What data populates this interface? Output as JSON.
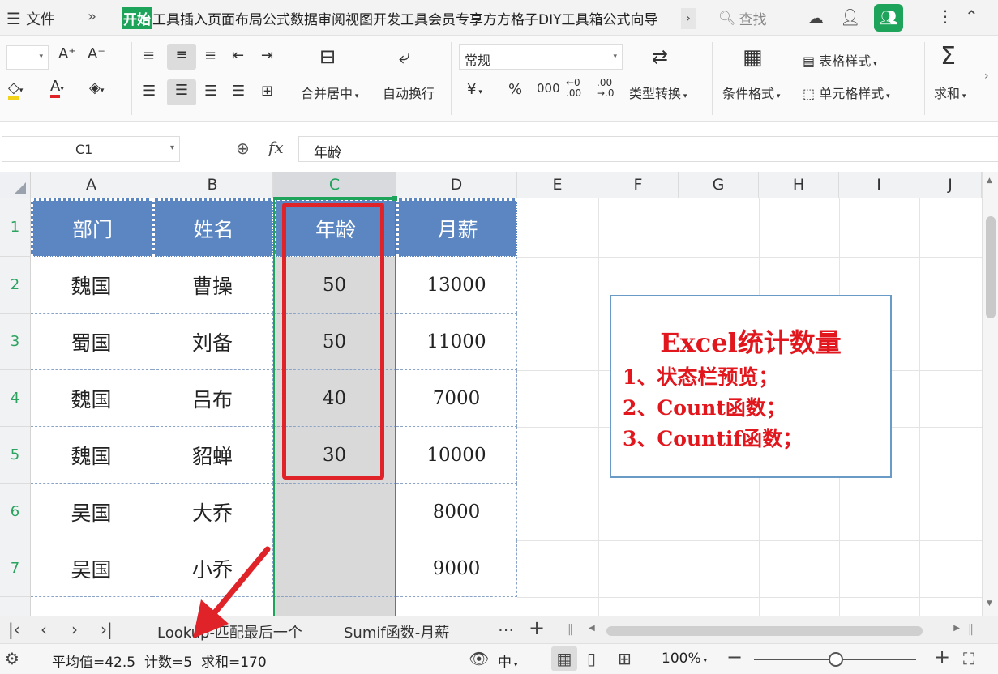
{
  "titlebar": {
    "menu_label": "文件",
    "tabs": [
      "开始",
      "工具",
      "插入",
      "页面布局",
      "公式",
      "数据",
      "审阅",
      "视图",
      "开发工具",
      "会员专享",
      "方方格子",
      "DIY工具箱",
      "公式向导"
    ],
    "search_label": "查找"
  },
  "ribbon": {
    "merge_label": "合并居中",
    "wrap_label": "自动换行",
    "number_format": "常规",
    "convert_label": "类型转换",
    "cond_format_label": "条件格式",
    "table_style_label": "表格样式",
    "cell_style_label": "单元格样式",
    "sum_label": "求和",
    "currency_symbol": "¥",
    "percent_symbol": "%",
    "thousands_symbol": "000",
    "inc_decimal_symbol": "←0\n.00",
    "dec_decimal_symbol": ".00\n→.0"
  },
  "formula_bar": {
    "name_box": "C1",
    "fx_label": "fx",
    "content": "年龄"
  },
  "columns": [
    "A",
    "B",
    "C",
    "D",
    "E",
    "F",
    "G",
    "H",
    "I",
    "J"
  ],
  "rows": [
    "1",
    "2",
    "3",
    "4",
    "5",
    "6",
    "7"
  ],
  "table": {
    "header": [
      "部门",
      "姓名",
      "年龄",
      "月薪"
    ],
    "rows": [
      [
        "魏国",
        "曹操",
        "50",
        "13000"
      ],
      [
        "蜀国",
        "刘备",
        "50",
        "11000"
      ],
      [
        "魏国",
        "吕布",
        "40",
        "7000"
      ],
      [
        "魏国",
        "貂蝉",
        "30",
        "10000"
      ],
      [
        "吴国",
        "大乔",
        "",
        "8000"
      ],
      [
        "吴国",
        "小乔",
        "",
        "9000"
      ]
    ]
  },
  "textbox": {
    "title": "Excel统计数量",
    "lines": [
      "1、状态栏预览；",
      "2、Count函数；",
      "3、Countif函数；"
    ]
  },
  "sheets": {
    "tab1": "Lookup-匹配最后一个",
    "tab2": "Sumif函数-月薪"
  },
  "status": {
    "avg": "平均值=42.5",
    "count": "计数=5",
    "sum": "求和=170",
    "zoom": "100%",
    "lang_label": "中"
  },
  "colors": {
    "accent": "#1ea35b",
    "header_fill": "#5b86c1",
    "highlight_red": "#e02229"
  }
}
